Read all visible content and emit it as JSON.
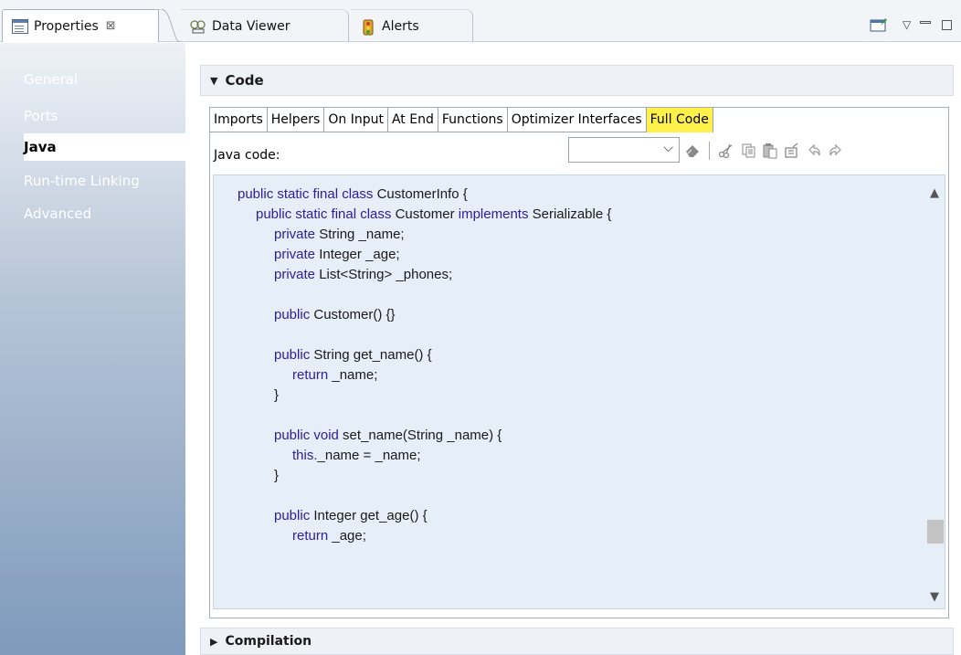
{
  "tabs": [
    {
      "label": "Properties",
      "icon": "properties-icon",
      "active": true,
      "close": "⊠"
    },
    {
      "label": "Data Viewer",
      "icon": "data-viewer-icon",
      "active": false
    },
    {
      "label": "Alerts",
      "icon": "alerts-icon",
      "active": false
    }
  ],
  "view_controls": {
    "pin": "pin-icon",
    "menu": "▽",
    "minimize": "▭",
    "maximize": "▢"
  },
  "sidebar": {
    "items": [
      {
        "label": "General"
      },
      {
        "label": "Ports"
      },
      {
        "label": "Java",
        "selected": true
      },
      {
        "label": "Run-time Linking"
      },
      {
        "label": "Advanced"
      }
    ]
  },
  "code_section": {
    "title": "Code",
    "expanded": true,
    "subtabs": [
      "Imports",
      "Helpers",
      "On Input",
      "At End",
      "Functions",
      "Optimizer Interfaces",
      "Full Code"
    ],
    "active_subtab": "Full Code",
    "java_code_label": "Java code:",
    "combo_value": "",
    "toolbar_icons": [
      "eraser-icon",
      "cut-icon",
      "copy-icon",
      "paste-icon",
      "format-icon",
      "undo-icon",
      "redo-icon"
    ]
  },
  "code_lines": [
    {
      "indent": 0,
      "kw": "public static final class",
      "rest": " CustomerInfo {"
    },
    {
      "indent": 1,
      "kw": "public static final class",
      "rest": " Customer ",
      "kw2": "implements",
      "rest2": " Serializable {"
    },
    {
      "indent": 2,
      "kw": "private",
      "rest": " String _name;"
    },
    {
      "indent": 2,
      "kw": "private",
      "rest": " Integer _age;"
    },
    {
      "indent": 2,
      "kw": "private",
      "rest": " List<String> _phones;"
    },
    {
      "indent": 0,
      "kw": "",
      "rest": ""
    },
    {
      "indent": 2,
      "kw": "public",
      "rest": " Customer() {}"
    },
    {
      "indent": 0,
      "kw": "",
      "rest": ""
    },
    {
      "indent": 2,
      "kw": "public",
      "rest": " String get_name() {"
    },
    {
      "indent": 3,
      "kw": "return",
      "rest": " _name;"
    },
    {
      "indent": 2,
      "kw": "",
      "rest": "}"
    },
    {
      "indent": 0,
      "kw": "",
      "rest": ""
    },
    {
      "indent": 2,
      "kw": "public void",
      "rest": " set_name(String _name) {"
    },
    {
      "indent": 3,
      "kw": "this.",
      "rest": "_name = _name;"
    },
    {
      "indent": 2,
      "kw": "",
      "rest": "}"
    },
    {
      "indent": 0,
      "kw": "",
      "rest": ""
    },
    {
      "indent": 2,
      "kw": "public",
      "rest": " Integer get_age() {"
    },
    {
      "indent": 3,
      "kw": "return",
      "rest": " _age;"
    }
  ],
  "compilation_section": {
    "title": "Compilation",
    "expanded": false
  },
  "colors": {
    "keyword": "#2c1c9e",
    "active_subtab": "#fff04a",
    "editor_bg": "#e6eef8"
  }
}
